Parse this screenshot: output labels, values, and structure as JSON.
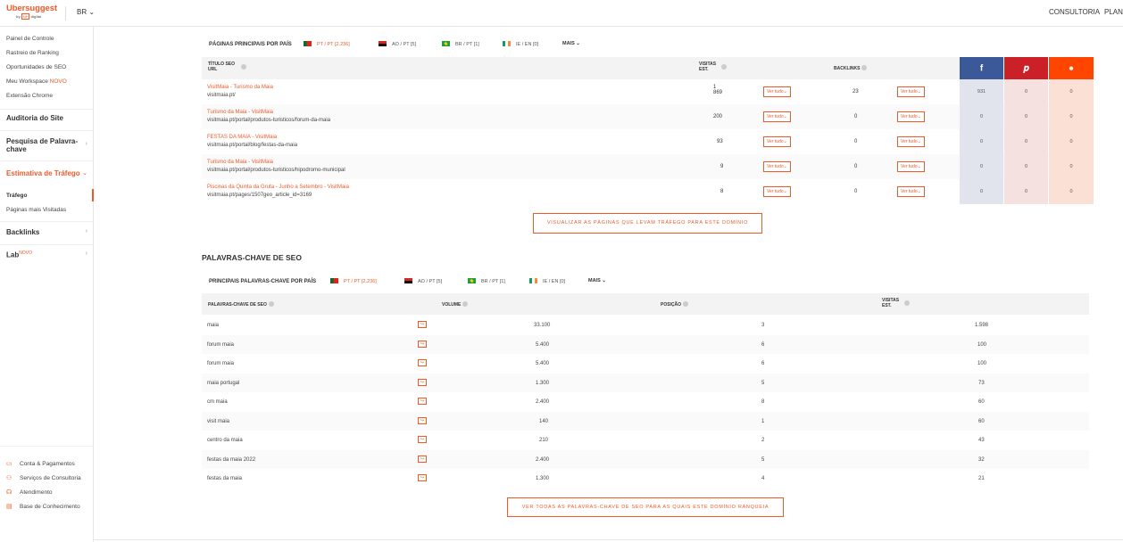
{
  "header": {
    "brand": "Ubersuggest",
    "by_prefix": "by",
    "by_box": "NP",
    "by_suffix": "digital",
    "lang": "BR",
    "consultoria": "CONSULTORIA",
    "planos": "PLANOS"
  },
  "sidebar": {
    "links": [
      "Painel de Controle",
      "Rastreio de Ranking",
      "Oportunidades de SEO",
      "Meu Workspace",
      "Extensão Chrome"
    ],
    "novo": "NOVO",
    "auditoria": "Auditoria do Site",
    "pesquisa_line1": "Pesquisa de Palavra-",
    "pesquisa_line2": "chave",
    "estimativa": "Estimativa de Tráfego",
    "trafego": "Tráfego",
    "paginas_visitadas": "Páginas mais Visitadas",
    "backlinks": "Backlinks",
    "lab": "Lab",
    "lab_novo": "NOVO",
    "footer": [
      "Conta & Pagamentos",
      "Serviços de Consultoria",
      "Atendimento",
      "Base de Conhecimento"
    ]
  },
  "pages_section": {
    "title": "PÁGINAS PRINCIPAIS POR PAÍS",
    "countries": [
      "PT / PT [2.236]",
      "AO / PT [5]",
      "BR / PT [1]",
      "IE / EN [0]"
    ],
    "mais": "MAIS",
    "col_title_line1": "TÍTULO SEO",
    "col_title_line2": "URL",
    "col_visits_line1": "VISITAS",
    "col_visits_line2": "EST.",
    "col_backlinks": "BACKLINKS",
    "ver_tudo": "Ver tudo",
    "rows": [
      {
        "title": "VisitMaia - Turismo da Maia",
        "url": "visitmaia.pt/",
        "visits_line1": "1",
        "visits_line2": "869",
        "backlinks": "23",
        "fb": "931",
        "pin": "0",
        "reddit": "0"
      },
      {
        "title": "Turismo da Maia - VisitMaia",
        "url": "visitmaia.pt/portal/produtos-turisticos/forum-da-maia",
        "visits_line1": "200",
        "visits_line2": "",
        "backlinks": "0",
        "fb": "0",
        "pin": "0",
        "reddit": "0"
      },
      {
        "title": "FESTAS DA MAIA - VisitMaia",
        "url": "visitmaia.pt/portal/blog/festas-da-maia",
        "visits_line1": "93",
        "visits_line2": "",
        "backlinks": "0",
        "fb": "0",
        "pin": "0",
        "reddit": "0"
      },
      {
        "title": "Turismo da Maia - VisitMaia",
        "url": "visitmaia.pt/portal/produtos-turisticos/hipodromo-municipal",
        "visits_line1": "9",
        "visits_line2": "",
        "backlinks": "0",
        "fb": "0",
        "pin": "0",
        "reddit": "0"
      },
      {
        "title": "Piscinas da Quinta da Gruta - Junho a Setembro - VisitMaia",
        "url": "visitmaia.pt/pages/1507geo_article_id=3169",
        "visits_line1": "8",
        "visits_line2": "",
        "backlinks": "0",
        "fb": "0",
        "pin": "0",
        "reddit": "0"
      }
    ],
    "cta": "VISUALIZAR AS PÁGINAS QUE LEVAM TRÁFEGO PARA ESTE DOMÍNIO"
  },
  "keywords_section": {
    "heading": "PALAVRAS-CHAVE DE SEO",
    "title": "PRINCIPAIS PALAVRAS-CHAVE POR PAÍS",
    "countries": [
      "PT / PT [2.236]",
      "AO / PT [5]",
      "BR / PT [1]",
      "IE / EN [0]"
    ],
    "mais": "MAIS",
    "col_keyword": "PALAVRAS-CHAVE DE SEO",
    "col_volume": "VOLUME",
    "col_position": "POSIÇÃO",
    "col_visits_line1": "VISITAS",
    "col_visits_line2": "EST.",
    "rows": [
      {
        "keyword": "maia",
        "volume": "33.100",
        "position": "3",
        "visits": "1.598"
      },
      {
        "keyword": "forum maia",
        "volume": "5.400",
        "position": "6",
        "visits": "100"
      },
      {
        "keyword": "forum maia",
        "volume": "5.400",
        "position": "6",
        "visits": "100"
      },
      {
        "keyword": "maia portugal",
        "volume": "1.300",
        "position": "5",
        "visits": "73"
      },
      {
        "keyword": "cm maia",
        "volume": "2.400",
        "position": "8",
        "visits": "60"
      },
      {
        "keyword": "visit maia",
        "volume": "140",
        "position": "1",
        "visits": "60"
      },
      {
        "keyword": "centro da maia",
        "volume": "210",
        "position": "2",
        "visits": "43"
      },
      {
        "keyword": "festas da maia 2022",
        "volume": "2.400",
        "position": "5",
        "visits": "32"
      },
      {
        "keyword": "festas da maia",
        "volume": "1.300",
        "position": "4",
        "visits": "21"
      }
    ],
    "cta": "VER TODAS AS PALAVRAS-CHAVE DE SEO PARA AS QUAIS ESTE DOMÍNIO RANQUEIA"
  },
  "colors": {
    "accent": "#f05a28",
    "facebook": "#3b5998",
    "pinterest": "#cb2027",
    "reddit": "#ff4500"
  }
}
